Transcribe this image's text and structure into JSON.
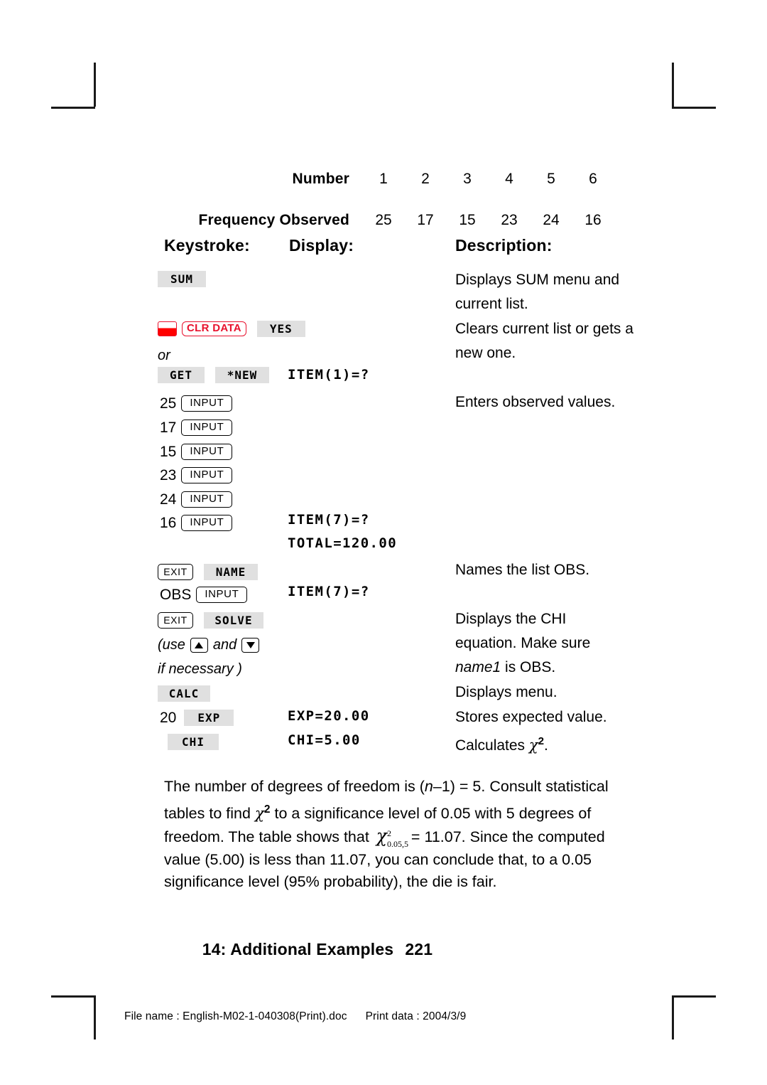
{
  "frequency_table": {
    "rows": [
      {
        "label": "Number",
        "values": [
          "1",
          "2",
          "3",
          "4",
          "5",
          "6"
        ]
      },
      {
        "label": "Frequency Observed",
        "values": [
          "25",
          "17",
          "15",
          "23",
          "24",
          "16"
        ]
      }
    ]
  },
  "column_headings": {
    "keystroke": "Keystroke:",
    "display": "Display:",
    "description": "Description:"
  },
  "keystrokes": {
    "sum": "SUM",
    "clr_data": "CLR DATA",
    "yes": "YES",
    "or": "or",
    "get": "GET",
    "new": "*NEW",
    "input": "INPUT",
    "exit": "EXIT",
    "name": "NAME",
    "solve": "SOLVE",
    "calc": "CALC",
    "exp": "EXP",
    "chi": "CHI",
    "obs": "OBS",
    "value_25": "25",
    "value_17": "17",
    "value_15": "15",
    "value_23": "23",
    "value_24": "24",
    "value_16": "16",
    "value_20": "20",
    "use_note_open": "(use",
    "use_note_and": "and",
    "use_note_close": "if necessary )"
  },
  "display": {
    "item1": "ITEM(1)=?",
    "item7_a": "ITEM(7)=?",
    "total": "TOTAL=120.00",
    "item7_b": "ITEM(7)=?",
    "exp": "EXP=20.00",
    "chi": "CHI=5.00"
  },
  "descriptions": {
    "sum_l1": "Displays SUM menu and",
    "sum_l2": "current list.",
    "clr_l1": "Clears current list or gets a",
    "clr_l2": "new one.",
    "enters": "Enters observed values.",
    "names": "Names the list OBS.",
    "solve_l1": "Displays the CHI",
    "solve_l2": "equation. Make sure",
    "solve_l3_pre": "name1",
    "solve_l3_post": " is OBS.",
    "calc": "Displays menu.",
    "exp": "Stores expected value.",
    "chi_pre": "Calculates ",
    "chi_sym": "χ",
    "chi_sup": "2",
    "chi_post": "."
  },
  "paragraph": {
    "s1_a": "The number of degrees of freedom is (",
    "s1_n": "n",
    "s1_b": "–1) = 5. Consult statistical tables to find ",
    "s1_chi": "χ",
    "s1_chi_sup": "2",
    "s1_c": " to a significance level of 0.05 with 5 degrees of freedom. The table shows that ",
    "chi_sub_sym": "χ",
    "chi_sub_sup": "2",
    "chi_sub_sub": "0.05,5",
    "s1_d": " = 11.07. Since the computed value (5.00) is less than 11.07, you can conclude that, to a 0.05 significance level (95% probability), the die is fair."
  },
  "chapter_footer": {
    "title": "14: Additional Examples",
    "page": "221"
  },
  "print_footer": {
    "file_label": "File name : English-M02-1-040308(Print).doc",
    "print_label": "Print data : 2004/3/9"
  },
  "colors": {
    "shift_red": "#ff0000",
    "key_gray": "#e0e0e0",
    "text_black": "#000000"
  }
}
